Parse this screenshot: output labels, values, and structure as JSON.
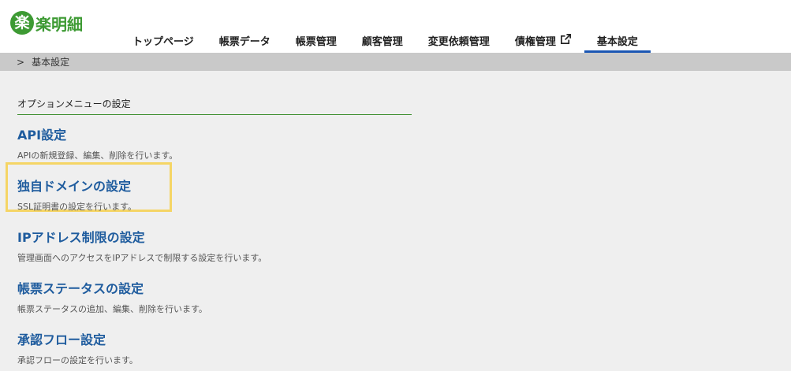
{
  "app": {
    "logo_mark": "楽",
    "logo_text": "楽明細"
  },
  "nav": {
    "items": [
      {
        "label": "トップページ"
      },
      {
        "label": "帳票データ"
      },
      {
        "label": "帳票管理"
      },
      {
        "label": "顧客管理"
      },
      {
        "label": "変更依頼管理"
      },
      {
        "label": "債権管理",
        "icon": "external-link-icon"
      },
      {
        "label": "基本設定",
        "active": true
      }
    ]
  },
  "breadcrumb": {
    "separator": ">",
    "current": "基本設定"
  },
  "section": {
    "title": "オプションメニューの設定"
  },
  "menu": [
    {
      "title": "API設定",
      "desc": "APIの新規登録、編集、削除を行います。"
    },
    {
      "title": "独自ドメインの設定",
      "desc": "SSL証明書の設定を行います。"
    },
    {
      "title": "IPアドレス制限の設定",
      "desc": "管理画面へのアクセスをIPアドレスで制限する設定を行います。"
    },
    {
      "title": "帳票ステータスの設定",
      "desc": "帳票ステータスの追加、編集、削除を行います。"
    },
    {
      "title": "承認フロー設定",
      "desc": "承認フローの設定を行います。"
    }
  ],
  "colors": {
    "brand": "#3d9a33",
    "link": "#1f5c9e",
    "active_tab": "#1a56b3",
    "highlight": "#f5d565"
  }
}
